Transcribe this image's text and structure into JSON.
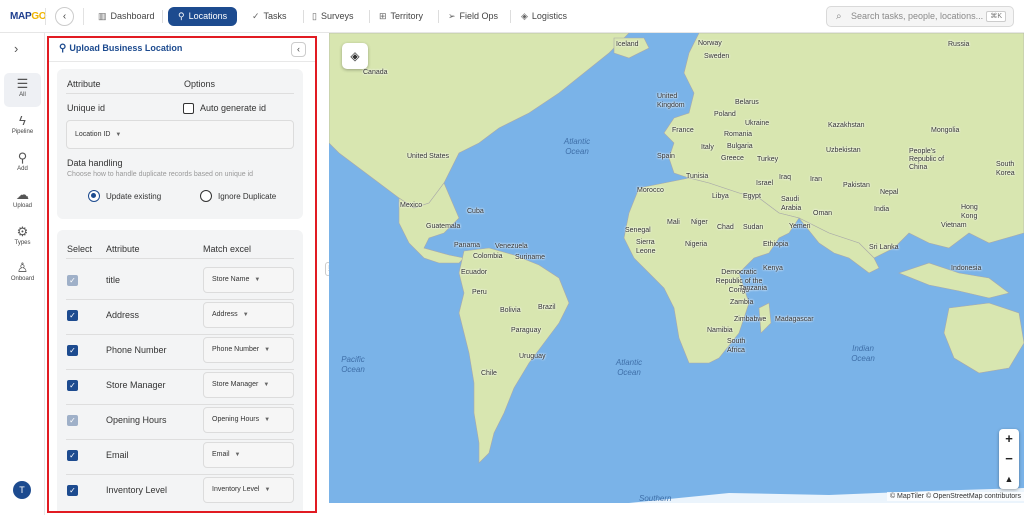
{
  "app": {
    "logo_text": "MAP",
    "logo_accent": "GO"
  },
  "nav": {
    "items": [
      {
        "label": "Dashboard",
        "icon": "bar-chart-icon"
      },
      {
        "label": "Locations",
        "icon": "map-pin-icon",
        "active": true
      },
      {
        "label": "Tasks",
        "icon": "check-icon"
      },
      {
        "label": "Surveys",
        "icon": "clipboard-icon"
      },
      {
        "label": "Territory",
        "icon": "map-icon"
      },
      {
        "label": "Field Ops",
        "icon": "send-icon"
      },
      {
        "label": "Logistics",
        "icon": "box-icon"
      }
    ]
  },
  "search": {
    "placeholder": "Search tasks, people, locations...",
    "shortcut": "⌘K"
  },
  "sidebar": {
    "items": [
      {
        "label": "All",
        "icon": "list-icon",
        "active": true
      },
      {
        "label": "Pipeline",
        "icon": "lightning-icon"
      },
      {
        "label": "Add",
        "icon": "map-pin-icon"
      },
      {
        "label": "Upload",
        "icon": "cloud-upload-icon"
      },
      {
        "label": "Types",
        "icon": "gear-icon"
      },
      {
        "label": "Onboard",
        "icon": "user-add-icon"
      }
    ],
    "avatar_initial": "T"
  },
  "panel": {
    "title": "Upload Business Location",
    "attribute_header": "Attribute",
    "options_header": "Options",
    "unique_id_label": "Unique id",
    "auto_generate_label": "Auto generate id",
    "auto_generate_checked": false,
    "location_select": "Location ID",
    "data_handling_label": "Data handling",
    "data_handling_note": "Choose how to handle duplicate records based on unique id",
    "radio_update": "Update existing",
    "radio_ignore": "Ignore Duplicate",
    "selected_option": "update",
    "mapping": {
      "headers": {
        "select": "Select",
        "attribute": "Attribute",
        "match": "Match excel"
      },
      "rows": [
        {
          "attribute": "title",
          "match": "Store Name",
          "checked": true,
          "locked": true
        },
        {
          "attribute": "Address",
          "match": "Address",
          "checked": true,
          "locked": false
        },
        {
          "attribute": "Phone Number",
          "match": "Phone Number",
          "checked": true,
          "locked": false
        },
        {
          "attribute": "Store Manager",
          "match": "Store Manager",
          "checked": true,
          "locked": false
        },
        {
          "attribute": "Opening Hours",
          "match": "Opening Hours",
          "checked": true,
          "locked": true
        },
        {
          "attribute": "Email",
          "match": "Email",
          "checked": true,
          "locked": false
        },
        {
          "attribute": "Inventory Level",
          "match": "Inventory Level",
          "checked": true,
          "locked": false
        }
      ]
    }
  },
  "map": {
    "attribution": "© MapTiler © OpenStreetMap contributors",
    "labels": [
      "Canada",
      "United States",
      "Mexico",
      "Cuba",
      "Guatemala",
      "Panama",
      "Colombia",
      "Venezuela",
      "Suriname",
      "Ecuador",
      "Peru",
      "Brazil",
      "Bolivia",
      "Paraguay",
      "Chile",
      "Uruguay",
      "Iceland",
      "Norway",
      "Sweden",
      "Russia",
      "United Kingdom",
      "Belarus",
      "Poland",
      "Ukraine",
      "France",
      "Romania",
      "Italy",
      "Bulgaria",
      "Spain",
      "Greece",
      "Turkey",
      "Kazakhstan",
      "Mongolia",
      "Uzbekistan",
      "People's Republic of China",
      "Morocco",
      "Tunisia",
      "Libya",
      "Egypt",
      "Iraq",
      "Iran",
      "Pakistan",
      "Nepal",
      "Saudi Arabia",
      "Oman",
      "India",
      "Hong Kong",
      "Mali",
      "Niger",
      "Chad",
      "Sudan",
      "Yemen",
      "Senegal",
      "Sierra Leone",
      "Nigeria",
      "Ethiopia",
      "Sri Lanka",
      "Vietnam",
      "Democratic Republic of the Congo",
      "Kenya",
      "Tanzania",
      "Zambia",
      "Namibia",
      "Zimbabwe",
      "Madagascar",
      "South Africa",
      "Indonesia",
      "South Korea",
      "Israel"
    ],
    "oceans": [
      "Atlantic Ocean",
      "Pacific Ocean",
      "Atlantic Ocean",
      "Indian Ocean",
      "Southern"
    ]
  }
}
